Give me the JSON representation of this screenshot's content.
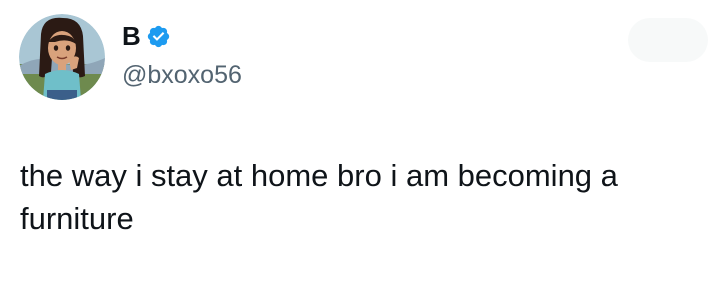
{
  "author": {
    "display_name": "B",
    "handle": "@bxoxo56",
    "verified": true,
    "avatar_icon": "cartoon-girl-avatar",
    "verified_icon": "verified-badge-icon",
    "verified_color": "#1d9bf0"
  },
  "tweet": {
    "text": "the way i stay at home bro i am becoming a furniture"
  },
  "colors": {
    "name": "#0f1419",
    "handle": "#536471",
    "text": "#0f1419",
    "background": "#ffffff"
  }
}
